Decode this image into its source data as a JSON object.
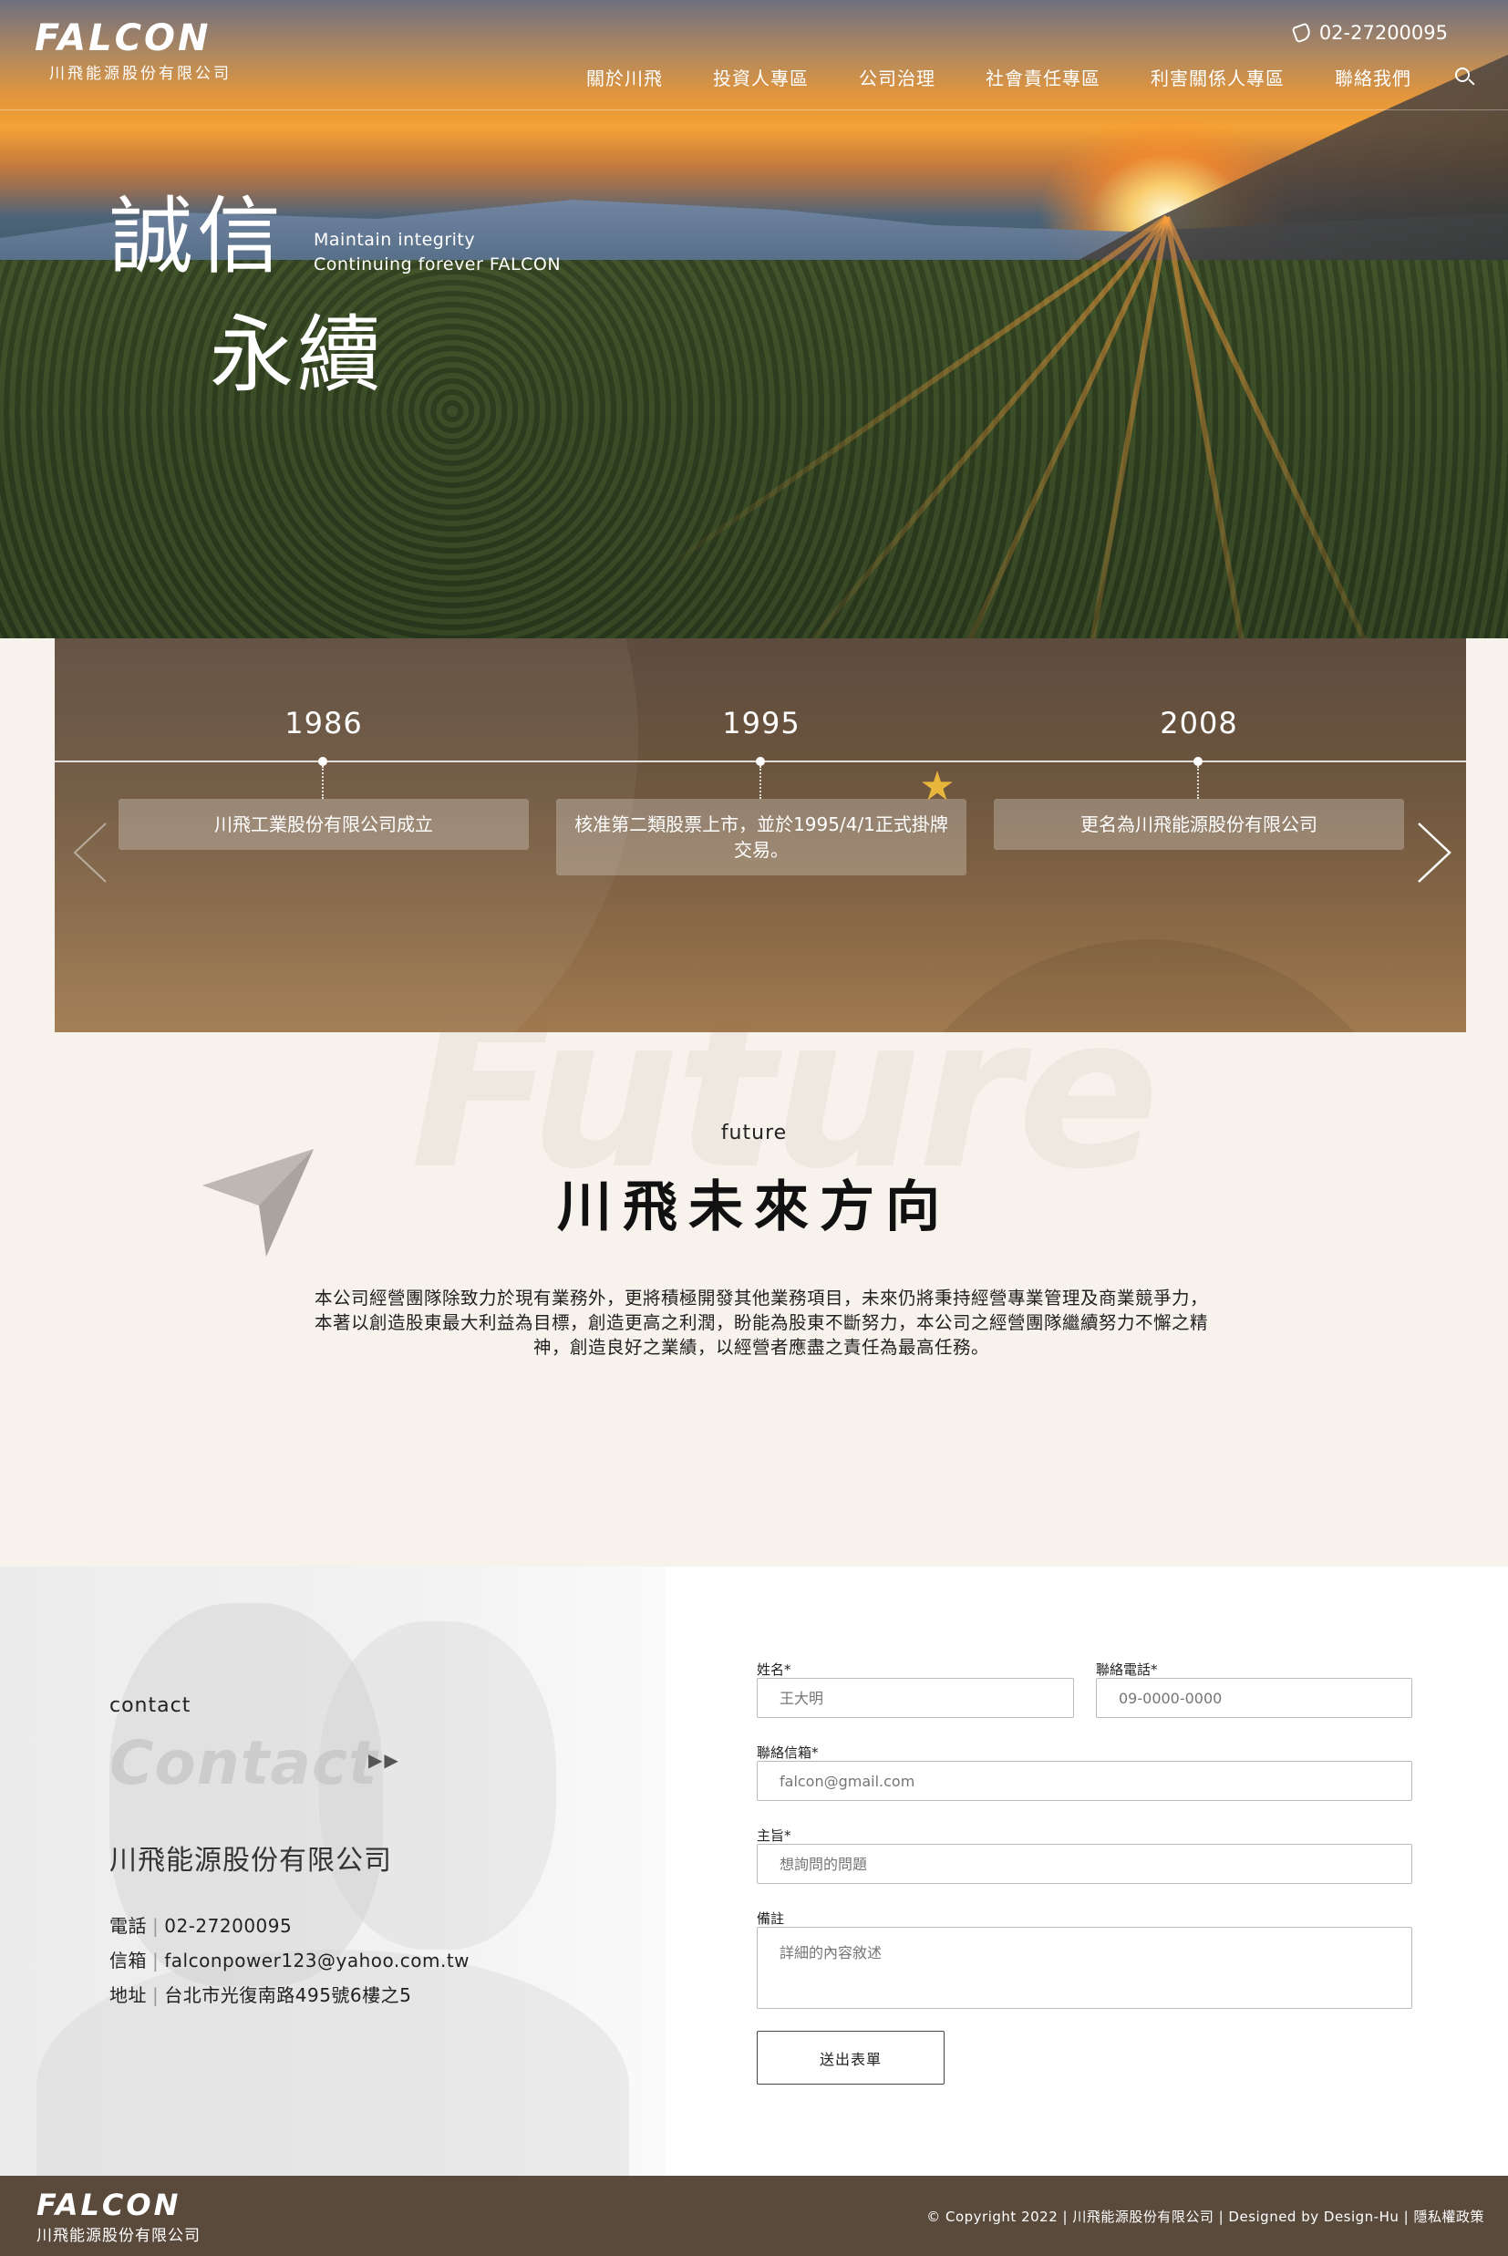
{
  "header": {
    "logo_brand": "FALCON",
    "logo_sub": "川飛能源股份有限公司",
    "phone": "02-27200095",
    "nav": [
      "關於川飛",
      "投資人專區",
      "公司治理",
      "社會責任專區",
      "利害關係人專區",
      "聯絡我們"
    ]
  },
  "hero": {
    "slogan_line1": "誠信",
    "slogan_line2": "永續",
    "slogan_en_1": "Maintain integrity",
    "slogan_en_2": "Continuing forever FALCON"
  },
  "timeline": {
    "items": [
      {
        "year": "1986",
        "text": "川飛工業股份有限公司成立"
      },
      {
        "year": "1995",
        "text": "核准第二類股票上市，並於1995/4/1正式掛牌交易。"
      },
      {
        "year": "2008",
        "text": "更名為川飛能源股份有限公司"
      }
    ]
  },
  "future": {
    "watermark": "Future",
    "small": "future",
    "title": "川飛未來方向",
    "body": "本公司經營團隊除致力於現有業務外，更將積極開發其他業務項目，未來仍將秉持經營專業管理及商業競爭力，本著以創造股東最大利益為目標，創造更高之利潤，盼能為股東不斷努力，本公司之經營團隊繼續努力不懈之精神，創造良好之業績，以經營者應盡之責任為最高任務。"
  },
  "contact": {
    "small": "contact",
    "watermark": "Contact",
    "arrows": "▶▶",
    "company": "川飛能源股份有限公司",
    "phone_label": "電話",
    "phone": "02-27200095",
    "email_label": "信箱",
    "email": "falconpower123@yahoo.com.tw",
    "address_label": "地址",
    "address": "台北市光復南路495號6樓之5"
  },
  "form": {
    "name_label": "姓名*",
    "name_placeholder": "王大明",
    "tel_label": "聯絡電話*",
    "tel_placeholder": "09-0000-0000",
    "email_label": "聯絡信箱*",
    "email_placeholder": "falcon@gmail.com",
    "subject_label": "主旨*",
    "subject_placeholder": "想詢問的問題",
    "note_label": "備註",
    "note_placeholder": "詳細的內容敘述",
    "submit": "送出表單"
  },
  "footer": {
    "logo_brand": "FALCON",
    "logo_sub": "川飛能源股份有限公司",
    "copyright": "© Copyright 2022 | 川飛能源股份有限公司 |  Designed by Design-Hu | ",
    "privacy": "隱私權政策"
  }
}
